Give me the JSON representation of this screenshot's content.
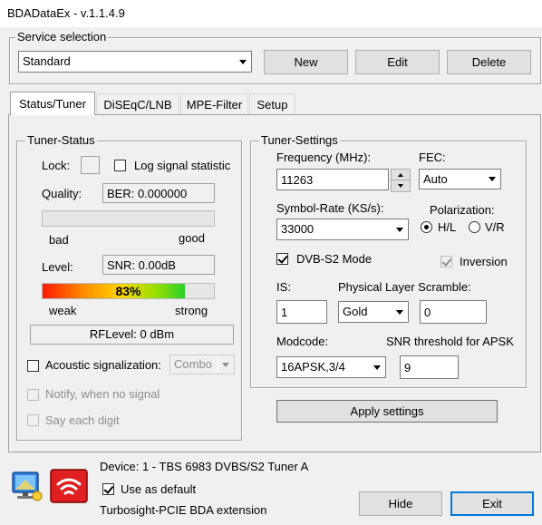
{
  "window": {
    "title": "BDADataEx - v.1.1.4.9"
  },
  "service": {
    "group_title": "Service selection",
    "selected": "Standard",
    "new_label": "New",
    "edit_label": "Edit",
    "delete_label": "Delete"
  },
  "tabs": [
    {
      "label": "Status/Tuner",
      "active": true
    },
    {
      "label": "DiSEqC/LNB",
      "active": false
    },
    {
      "label": "MPE-Filter",
      "active": false
    },
    {
      "label": "Setup",
      "active": false
    }
  ],
  "tuner_status": {
    "group_title": "Tuner-Status",
    "lock_label": "Lock:",
    "log_label": "Log signal statistic",
    "log_checked": false,
    "quality_label": "Quality:",
    "ber_text": "BER: 0.000000",
    "quality_fraction": 0,
    "bad_label": "bad",
    "good_label": "good",
    "level_label": "Level:",
    "snr_text": "SNR: 0.00dB",
    "level_percent_text": "83%",
    "level_fraction": 0.83,
    "weak_label": "weak",
    "strong_label": "strong",
    "rflevel_text": "RFLevel: 0 dBm",
    "acoustic_label": "Acoustic signalization:",
    "acoustic_checked": false,
    "acoustic_mode": "Combo",
    "notify_label": "Notify, when no signal",
    "say_digit_label": "Say each digit"
  },
  "tuner_settings": {
    "group_title": "Tuner-Settings",
    "frequency_label": "Frequency (MHz):",
    "frequency_value": "11263",
    "fec_label": "FEC:",
    "fec_value": "Auto",
    "symbol_rate_label": "Symbol-Rate (KS/s):",
    "symbol_rate_value": "33000",
    "polarization_label": "Polarization:",
    "pol_hl": "H/L",
    "pol_vr": "V/R",
    "pol_selected": "H/L",
    "dvbs2_label": "DVB-S2 Mode",
    "dvbs2_checked": true,
    "inversion_label": "Inversion",
    "inversion_checked": true,
    "is_label": "IS:",
    "is_value": "1",
    "pls_label": "Physical Layer Scramble:",
    "pls_mode": "Gold",
    "pls_value": "0",
    "modcode_label": "Modcode:",
    "modcode_value": "16APSK,3/4",
    "snr_threshold_label": "SNR threshold for APSK",
    "snr_threshold_value": "9",
    "apply_label": "Apply settings"
  },
  "footer": {
    "device_text": "Device: 1 - TBS 6983 DVBS/S2 Tuner A",
    "use_default_label": "Use as default",
    "use_default_checked": true,
    "extension_text": "Turbosight-PCIE BDA extension",
    "hide_label": "Hide",
    "exit_label": "Exit"
  },
  "icons": {
    "monitor": "computer-monitor-icon",
    "tbs": "tbs-logo-icon"
  },
  "colors": {
    "accent": "#0078d7",
    "tbs_red": "#e02020",
    "bar_low": "#ff1a00",
    "bar_mid": "#ffd400",
    "bar_high": "#2bd12b"
  }
}
